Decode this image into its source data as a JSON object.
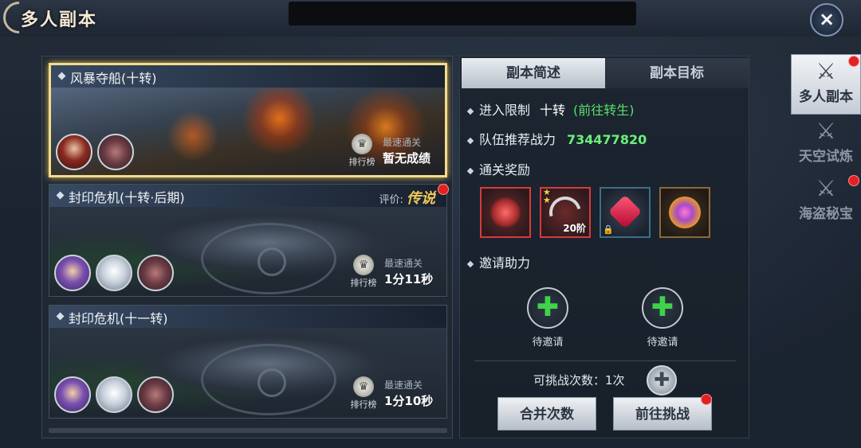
{
  "header": {
    "title": "多人副本",
    "close_icon": "×"
  },
  "dungeons": [
    {
      "name": "风暴夺船(十转)",
      "rank_label": "排行榜",
      "fastest_label": "最速通关",
      "fastest_value": "暂无成绩"
    },
    {
      "name": "封印危机(十转·后期)",
      "rating_label": "评价:",
      "rating_value": "传说",
      "rank_label": "排行榜",
      "fastest_label": "最速通关",
      "fastest_value": "1分11秒"
    },
    {
      "name": "封印危机(十一转)",
      "rank_label": "排行榜",
      "fastest_label": "最速通关",
      "fastest_value": "1分10秒"
    }
  ],
  "tabs": {
    "overview": "副本简述",
    "goal": "副本目标"
  },
  "info": {
    "entry_label": "进入限制",
    "entry_value": "十转",
    "entry_link": "(前往转生)",
    "power_label": "队伍推荐战力",
    "power_value": "734477820",
    "reward_label": "通关奖励",
    "rewards": [
      {
        "icon": "claw-icon"
      },
      {
        "icon": "bow-icon",
        "level": "20阶"
      },
      {
        "icon": "ruby-icon",
        "lock": "🔒"
      },
      {
        "icon": "orb-icon"
      }
    ],
    "invite_label": "邀请助力",
    "invite_slot_label": "待邀请",
    "attempts_text": "可挑战次数：1次",
    "merge_button": "合并次数",
    "challenge_button": "前往挑战"
  },
  "sidebar": [
    {
      "label": "多人副本",
      "icon": "crossed-swords-icon"
    },
    {
      "label": "天空试炼",
      "icon": "crossed-swords-icon"
    },
    {
      "label": "海盗秘宝",
      "icon": "crossed-swords-icon"
    }
  ],
  "colors": {
    "accent_green": "#58e06a",
    "gold_rating": "#f2c85a",
    "selected_frame": "#f2dc8d",
    "red_dot": "#e02222"
  }
}
